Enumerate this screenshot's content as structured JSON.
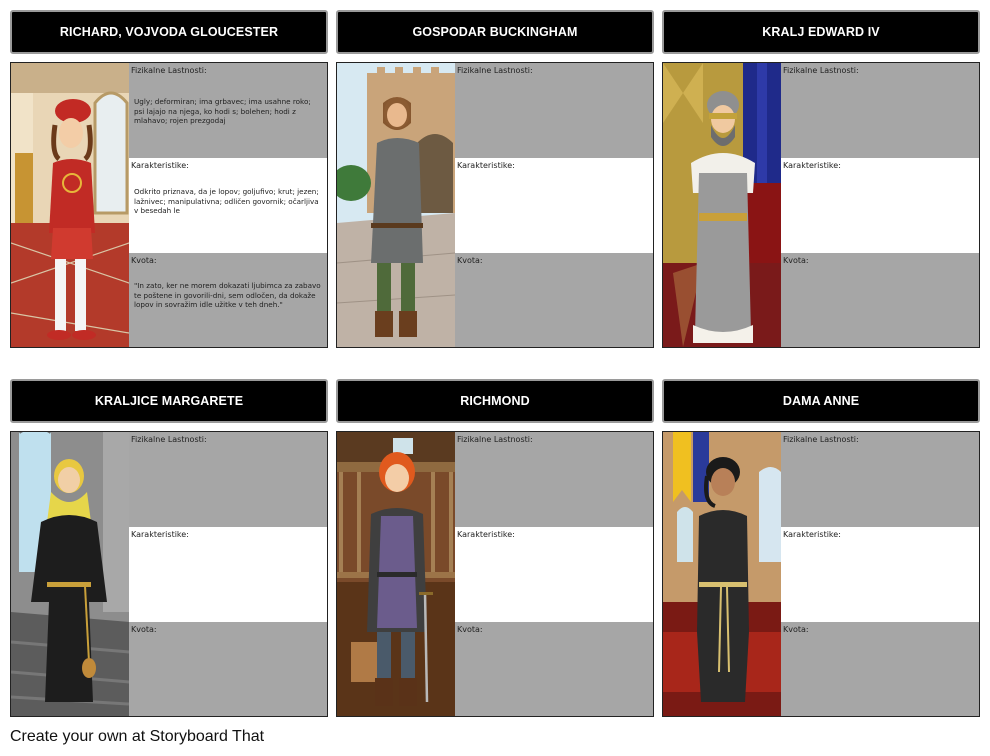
{
  "footer": "Create your own at Storyboard That",
  "labels": {
    "physical": "Fizikalne Lastnosti:",
    "character": "Karakteristike:",
    "quote": "Kvota:"
  },
  "cells": [
    {
      "title": "RICHARD, VOJVODA GLOUCESTER",
      "physical": "Ugly; deformiran; ima grbavec; ima usahne roko; psi lajajo na njega, ko hodi s; bolehen; hodi z mlahavo; rojen prezgodaj",
      "character": "Odkrito priznava, da je lopov; goljufivo; krut; jezen; lažnivec; manipulativna; odličen govornik; očarljiva v besedah le",
      "quote": "\"In zato, ker ne morem dokazati ljubimca za zabavo te poštene in govorili-dni, sem odločen, da dokaže lopov in sovražim idle užitke v teh dneh.\""
    },
    {
      "title": "GOSPODAR BUCKINGHAM",
      "physical": "",
      "character": "",
      "quote": ""
    },
    {
      "title": "KRALJ EDWARD IV",
      "physical": "",
      "character": "",
      "quote": ""
    },
    {
      "title": "KRALJICE MARGARETE",
      "physical": "",
      "character": "",
      "quote": ""
    },
    {
      "title": "RICHMOND",
      "physical": "",
      "character": "",
      "quote": ""
    },
    {
      "title": "DAMA ANNE",
      "physical": "",
      "character": "",
      "quote": ""
    }
  ],
  "colors": {
    "title_bg": "#000000",
    "field_gray": "#a6a6a6",
    "field_white": "#ffffff"
  }
}
